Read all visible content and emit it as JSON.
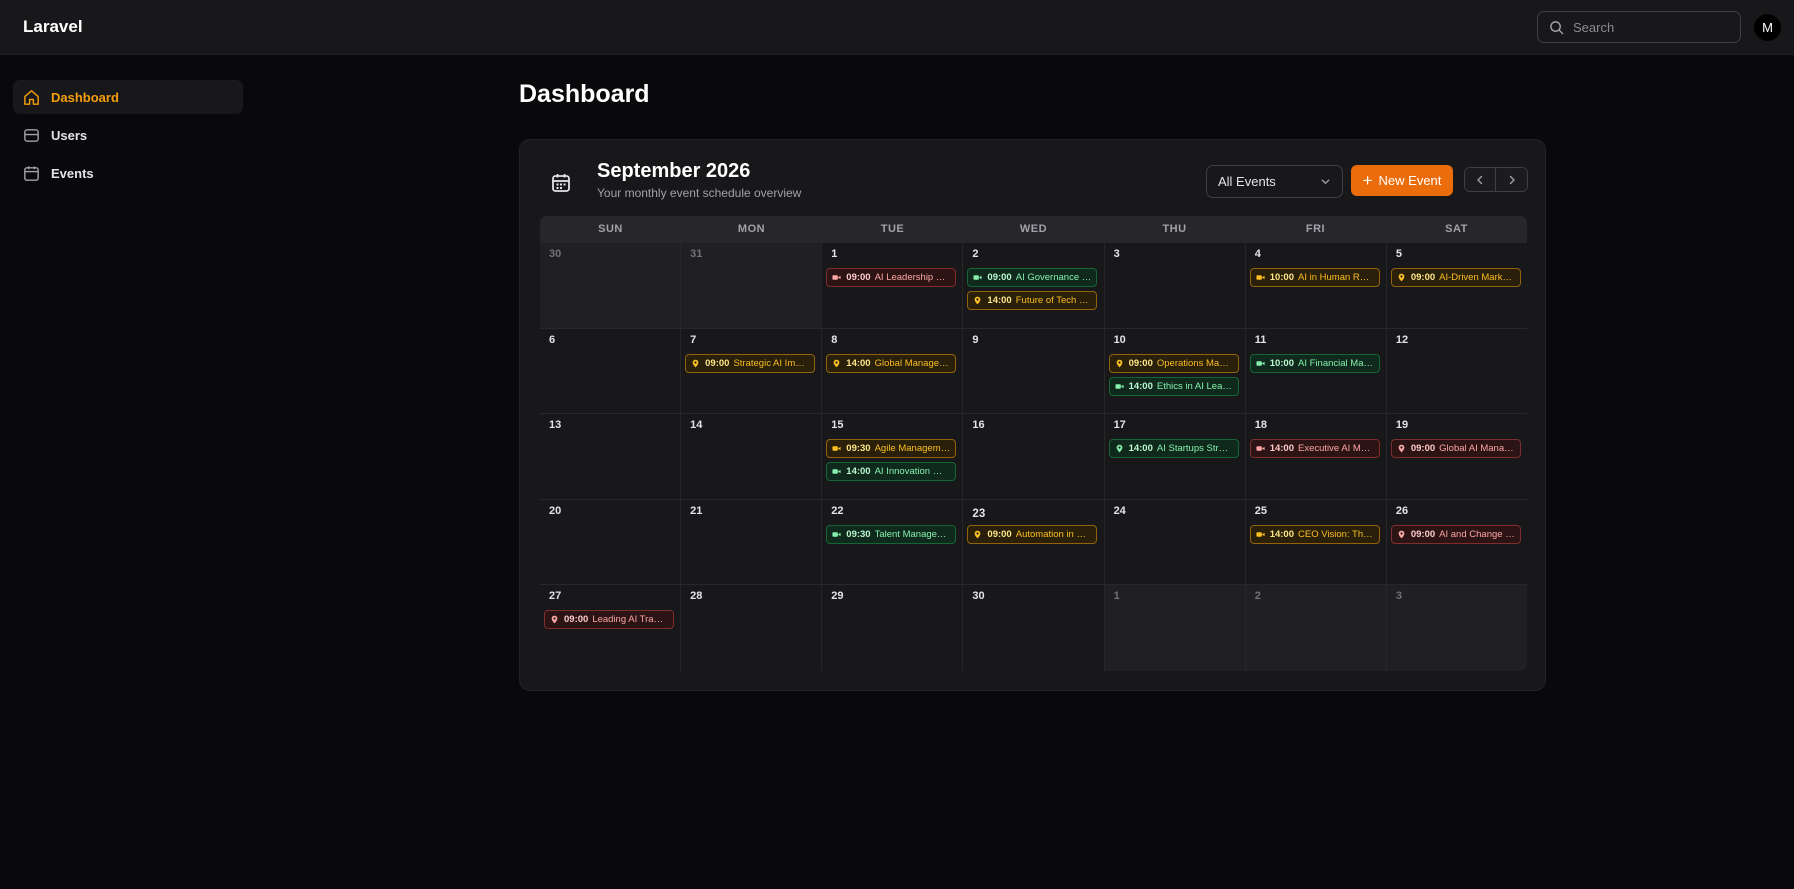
{
  "app": {
    "brand": "Laravel"
  },
  "search": {
    "placeholder": "Search"
  },
  "user": {
    "initial": "M"
  },
  "sidebar": {
    "items": [
      {
        "label": "Dashboard",
        "icon": "home-icon",
        "active": true
      },
      {
        "label": "Users",
        "icon": "inbox-icon",
        "active": false
      },
      {
        "label": "Events",
        "icon": "calendar-icon",
        "active": false
      }
    ]
  },
  "page": {
    "title": "Dashboard"
  },
  "calendar": {
    "title": "September 2026",
    "subtitle": "Your monthly event schedule overview",
    "filter": "All Events",
    "new_event_label": "New Event",
    "weekdays": [
      "SUN",
      "MON",
      "TUE",
      "WED",
      "THU",
      "FRI",
      "SAT"
    ],
    "colors": {
      "red": "#fca5a5",
      "green": "#86efac",
      "amber": "#fbbf24",
      "accent": "#f59e0b",
      "button": "#ea6c0a"
    },
    "weeks": [
      [
        {
          "day": "30",
          "muted": true,
          "events": []
        },
        {
          "day": "31",
          "muted": true,
          "events": []
        },
        {
          "day": "1",
          "events": [
            {
              "time": "09:00",
              "title": "AI Leadership Su...",
              "color": "red",
              "icon": "video-icon"
            }
          ]
        },
        {
          "day": "2",
          "events": [
            {
              "time": "09:00",
              "title": "AI Governance S...",
              "color": "green",
              "icon": "video-icon"
            },
            {
              "time": "14:00",
              "title": "Future of Tech M...",
              "color": "amber",
              "icon": "location-icon"
            }
          ]
        },
        {
          "day": "3",
          "events": []
        },
        {
          "day": "4",
          "events": [
            {
              "time": "10:00",
              "title": "AI in Human Reso...",
              "color": "amber",
              "icon": "video-icon"
            }
          ]
        },
        {
          "day": "5",
          "events": [
            {
              "time": "09:00",
              "title": "AI-Driven Marketi...",
              "color": "amber",
              "icon": "location-icon"
            }
          ]
        }
      ],
      [
        {
          "day": "6",
          "events": []
        },
        {
          "day": "7",
          "events": [
            {
              "time": "09:00",
              "title": "Strategic AI Imple...",
              "color": "amber",
              "icon": "location-icon"
            }
          ]
        },
        {
          "day": "8",
          "events": [
            {
              "time": "14:00",
              "title": "Global Manageme...",
              "color": "amber",
              "icon": "location-icon"
            }
          ]
        },
        {
          "day": "9",
          "events": []
        },
        {
          "day": "10",
          "events": [
            {
              "time": "09:00",
              "title": "Operations Mana...",
              "color": "amber",
              "icon": "location-icon"
            },
            {
              "time": "14:00",
              "title": "Ethics in AI Leade...",
              "color": "green",
              "icon": "video-icon"
            }
          ]
        },
        {
          "day": "11",
          "events": [
            {
              "time": "10:00",
              "title": "AI Financial Mana...",
              "color": "green",
              "icon": "video-icon"
            }
          ]
        },
        {
          "day": "12",
          "events": []
        }
      ],
      [
        {
          "day": "13",
          "events": []
        },
        {
          "day": "14",
          "events": []
        },
        {
          "day": "15",
          "events": [
            {
              "time": "09:30",
              "title": "Agile Manageme...",
              "color": "amber",
              "icon": "video-icon"
            },
            {
              "time": "14:00",
              "title": "AI Innovation Wor...",
              "color": "green",
              "icon": "video-icon"
            }
          ]
        },
        {
          "day": "16",
          "events": []
        },
        {
          "day": "17",
          "events": [
            {
              "time": "14:00",
              "title": "AI Startups Strategy",
              "color": "green",
              "icon": "location-icon"
            }
          ]
        },
        {
          "day": "18",
          "events": [
            {
              "time": "14:00",
              "title": "Executive AI Mast...",
              "color": "red",
              "icon": "video-icon"
            }
          ]
        },
        {
          "day": "19",
          "events": [
            {
              "time": "09:00",
              "title": "Global AI Manag...",
              "color": "red",
              "icon": "location-icon"
            }
          ]
        }
      ],
      [
        {
          "day": "20",
          "events": []
        },
        {
          "day": "21",
          "events": []
        },
        {
          "day": "22",
          "events": [
            {
              "time": "09:30",
              "title": "Talent Managem...",
              "color": "green",
              "icon": "video-icon"
            }
          ]
        },
        {
          "day": "23",
          "today": true,
          "events": [
            {
              "time": "09:00",
              "title": "Automation in Op...",
              "color": "amber",
              "icon": "location-icon"
            }
          ]
        },
        {
          "day": "24",
          "events": []
        },
        {
          "day": "25",
          "events": [
            {
              "time": "14:00",
              "title": "CEO Vision: The ...",
              "color": "amber",
              "icon": "video-icon"
            }
          ]
        },
        {
          "day": "26",
          "events": [
            {
              "time": "09:00",
              "title": "AI and Change M...",
              "color": "red",
              "icon": "location-icon"
            }
          ]
        }
      ],
      [
        {
          "day": "27",
          "events": [
            {
              "time": "09:00",
              "title": "Leading AI Transf...",
              "color": "red",
              "icon": "location-icon"
            }
          ]
        },
        {
          "day": "28",
          "events": []
        },
        {
          "day": "29",
          "events": []
        },
        {
          "day": "30",
          "events": []
        },
        {
          "day": "1",
          "muted": true,
          "events": []
        },
        {
          "day": "2",
          "muted": true,
          "events": []
        },
        {
          "day": "3",
          "muted": true,
          "events": []
        }
      ]
    ]
  }
}
